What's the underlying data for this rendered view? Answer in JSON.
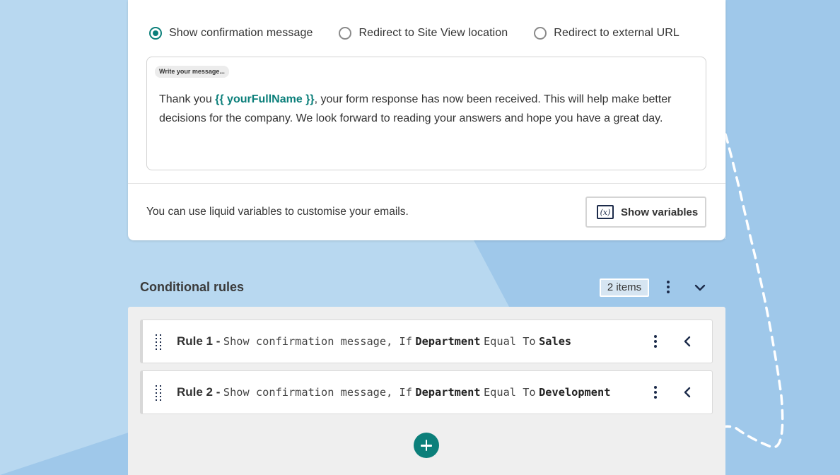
{
  "confirmation": {
    "options": [
      {
        "label": "Show confirmation message",
        "checked": true
      },
      {
        "label": "Redirect to Site View location",
        "checked": false
      },
      {
        "label": "Redirect to external URL",
        "checked": false
      }
    ],
    "message_hint": "Write your message...",
    "message": {
      "before": "Thank you ",
      "variable": "{{ yourFullName }}",
      "after": ", your form response has now been received. This will help make better decisions for the company. We look forward to reading your answers and hope you have a great day."
    },
    "footer_text": "You can use liquid variables to customise your emails.",
    "show_variables_label": "Show variables",
    "variables_icon_text": "(x)"
  },
  "conditional_rules": {
    "title": "Conditional rules",
    "count_label": "2 items",
    "rules": [
      {
        "name": "Rule 1 -",
        "action": "Show confirmation message, If",
        "field": "Department",
        "operator": "Equal To",
        "value": "Sales"
      },
      {
        "name": "Rule 2 -",
        "action": "Show confirmation message, If",
        "field": "Department",
        "operator": "Equal To",
        "value": "Development"
      }
    ]
  },
  "colors": {
    "accent": "#0b7f7a",
    "icon_dark": "#1c2b4a",
    "background": "#a7cdec"
  }
}
